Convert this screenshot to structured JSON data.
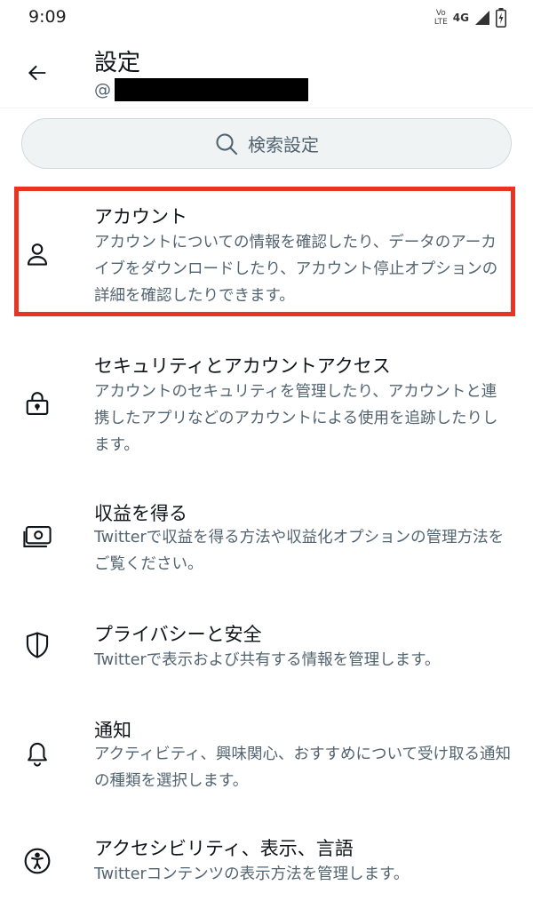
{
  "status": {
    "time": "9:09",
    "volte_top": "Vo",
    "volte_bottom": "LTE",
    "network": "4G"
  },
  "header": {
    "title": "設定",
    "handle_prefix": "@"
  },
  "search": {
    "label": "検索設定"
  },
  "items": [
    {
      "title": "アカウント",
      "desc": "アカウントについての情報を確認したり、データのアーカイブをダウンロードしたり、アカウント停止オプションの詳細を確認したりできます。",
      "icon": "person-icon"
    },
    {
      "title": "セキュリティとアカウントアクセス",
      "desc": "アカウントのセキュリティを管理したり、アカウントと連携したアプリなどのアカウントによる使用を追跡したりします。",
      "icon": "lock-icon"
    },
    {
      "title": "収益を得る",
      "desc": "Twitterで収益を得る方法や収益化オプションの管理方法をご覧ください。",
      "icon": "money-icon"
    },
    {
      "title": "プライバシーと安全",
      "desc": "Twitterで表示および共有する情報を管理します。",
      "icon": "shield-icon"
    },
    {
      "title": "通知",
      "desc": "アクティビティ、興味関心、おすすめについて受け取る通知の種類を選択します。",
      "icon": "bell-icon"
    },
    {
      "title": "アクセシビリティ、表示、言語",
      "desc": "Twitterコンテンツの表示方法を管理します。",
      "icon": "accessibility-icon"
    }
  ],
  "colors": {
    "highlight": "#ea3323",
    "text_primary": "#0f1419",
    "text_secondary": "#536471",
    "search_bg": "#eff3f4"
  }
}
